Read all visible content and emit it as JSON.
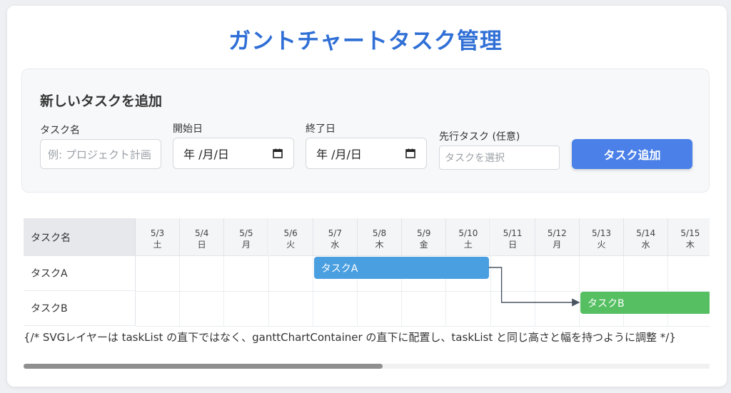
{
  "title": "ガントチャートタスク管理",
  "add_form": {
    "heading": "新しいタスクを追加",
    "task_name_label": "タスク名",
    "task_name_placeholder": "例: プロジェクト計画",
    "start_date_label": "開始日",
    "start_date_value": "年 /月/日",
    "end_date_label": "終了日",
    "end_date_value": "年 /月/日",
    "predecessor_label": "先行タスク (任意)",
    "predecessor_placeholder": "タスクを選択",
    "add_button_label": "タスク追加"
  },
  "gantt": {
    "name_header": "タスク名",
    "dates": [
      {
        "date": "5/3",
        "weekday": "土"
      },
      {
        "date": "5/4",
        "weekday": "日"
      },
      {
        "date": "5/5",
        "weekday": "月"
      },
      {
        "date": "5/6",
        "weekday": "火"
      },
      {
        "date": "5/7",
        "weekday": "水"
      },
      {
        "date": "5/8",
        "weekday": "木"
      },
      {
        "date": "5/9",
        "weekday": "金"
      },
      {
        "date": "5/10",
        "weekday": "土"
      },
      {
        "date": "5/11",
        "weekday": "日"
      },
      {
        "date": "5/12",
        "weekday": "月"
      },
      {
        "date": "5/13",
        "weekday": "火"
      },
      {
        "date": "5/14",
        "weekday": "水"
      },
      {
        "date": "5/15",
        "weekday": "木"
      }
    ],
    "tasks": [
      {
        "name": "タスクA",
        "start": "5/7",
        "end": "5/10",
        "color": "#4a9fe0"
      },
      {
        "name": "タスクB",
        "start": "5/13",
        "end": "5/15",
        "color": "#55bf62"
      }
    ],
    "dependency": {
      "from": "タスクA",
      "to": "タスクB"
    },
    "note": "{/* SVGレイヤーは taskList の直下ではなく、ganttChartContainer の直下に配置し、taskList と同じ高さと幅を持つように調整 */}"
  },
  "colors": {
    "title": "#2f6fd6",
    "button": "#4a80e8"
  }
}
